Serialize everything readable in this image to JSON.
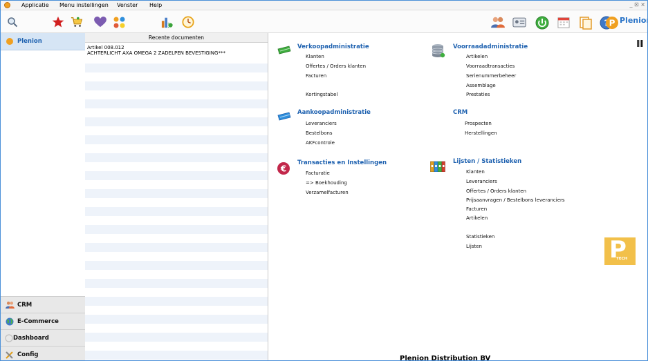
{
  "menubar": {
    "items": [
      "Applicatie",
      "Menu instellingen",
      "Venster",
      "Help"
    ],
    "window_controls": "_ ⊡ ×"
  },
  "toolbar": {
    "brand_label": "Plenion",
    "left_icons": [
      "search-icon",
      "star-icon",
      "cart-icon",
      "heart-icon",
      "dots-icon",
      "charts-icon",
      "clock-icon"
    ],
    "right_icons": [
      "users-icon",
      "id-card-icon",
      "green-power-icon",
      "calendar-icon",
      "documents-icon",
      "help-icon",
      "plenion-logo-icon"
    ]
  },
  "leftnav": {
    "top_label": "Plenion",
    "items": [
      {
        "label": "CRM"
      },
      {
        "label": "E-Commerce"
      },
      {
        "label": "Dashboard"
      },
      {
        "label": "Config"
      }
    ]
  },
  "recent": {
    "header": "Recente documenten",
    "entries": [
      {
        "line1": "Artikel 008.012",
        "line2": "ACHTERLICHT AXA OMEGA 2 ZADELPEN BEVESTIGING***"
      }
    ]
  },
  "main": {
    "sections": [
      {
        "id": "verkoop",
        "title": "Verkoopadministratie",
        "links": [
          "Klanten",
          "Offertes / Orders klanten",
          "Facturen",
          "Kortingstabel"
        ]
      },
      {
        "id": "aankoop",
        "title": "Aankoopadministratie",
        "links": [
          "Leveranciers",
          "Bestelbons",
          "AKFcontrole"
        ]
      },
      {
        "id": "transacties",
        "title": "Transacties en Instellingen",
        "links": [
          "Facturatie",
          "=> Boekhouding",
          "Verzamelfacturen"
        ]
      },
      {
        "id": "voorraad",
        "title": "Voorraadadministratie",
        "links": [
          "Artikelen",
          "Voorraadtransacties",
          "Serienummerbeheer",
          "Assemblage",
          "Prestaties"
        ]
      },
      {
        "id": "crm",
        "title": "CRM",
        "links": [
          "Prospecten",
          "Herstellingen"
        ]
      },
      {
        "id": "lijsten",
        "title": "Lijsten / Statistieken",
        "links": [
          "Klanten",
          "Leveranciers",
          "Offertes / Orders klanten",
          "Prijsaanvragen / Bestelbons leveranciers",
          "Facturen",
          "Artikelen",
          "Statistieken",
          "Lijsten"
        ]
      }
    ],
    "company": "Plenion Distribution BV",
    "ptech_logo": {
      "letter": "P",
      "text": "TECH"
    }
  },
  "colors": {
    "accent": "#1f62b0",
    "nav_selected_bg": "#d6e5f5",
    "row_alt": "#eef3fa",
    "logo_yellow": "#f2c04a"
  }
}
